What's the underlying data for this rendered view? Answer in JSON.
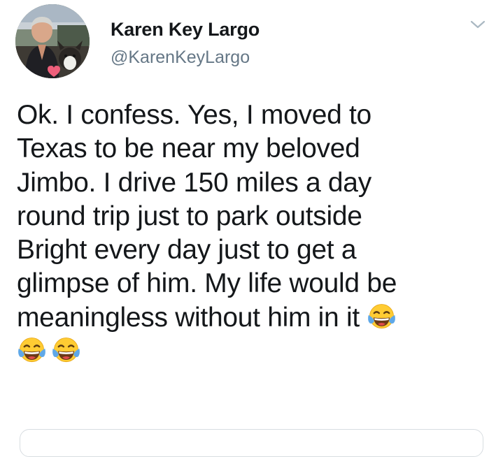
{
  "user": {
    "display_name": "Karen Key Largo",
    "handle": "@KarenKeyLargo",
    "avatar_icon": "profile-photo"
  },
  "menu": {
    "icon": "chevron-down-icon"
  },
  "tweet": {
    "lines": [
      "Ok. I confess. Yes, I moved to",
      "Texas to be near my beloved",
      "Jimbo. I drive 150 miles a day",
      "round trip just  to park outside",
      "Bright every day just to get a",
      "glimpse of  him. My life would be",
      "meaningless without him in it"
    ],
    "emoji": "face-with-tears-of-joy",
    "trailing_emoji_count": 2
  },
  "colors": {
    "text": "#14171a",
    "secondary": "#657786",
    "emoji_face": "#ffcc33",
    "emoji_tears": "#5fa8e8",
    "divider": "#d8dde1"
  }
}
